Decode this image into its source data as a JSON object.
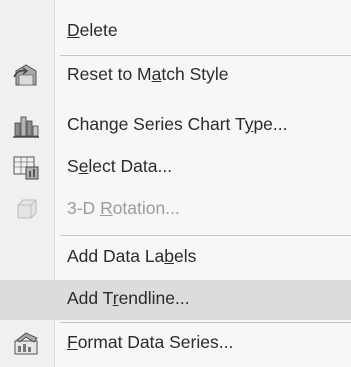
{
  "menu": {
    "items": [
      {
        "id": "delete",
        "pre": "",
        "key": "D",
        "post": "elete",
        "icon": "",
        "disabled": false,
        "hover": false
      },
      {
        "id": "reset-to-match-style",
        "pre": "Reset to M",
        "key": "a",
        "post": "tch Style",
        "icon": "reset-style-icon",
        "disabled": false,
        "hover": false
      },
      {
        "id": "change-series-chart-type",
        "pre": "Change Series Chart T",
        "key": "y",
        "post": "pe...",
        "icon": "chart-type-icon",
        "disabled": false,
        "hover": false
      },
      {
        "id": "select-data",
        "pre": "S",
        "key": "e",
        "post": "lect Data...",
        "icon": "select-data-icon",
        "disabled": false,
        "hover": false
      },
      {
        "id": "3d-rotation",
        "pre": "3-D ",
        "key": "R",
        "post": "otation...",
        "icon": "3d-rotation-icon",
        "disabled": true,
        "hover": false
      },
      {
        "id": "add-data-labels",
        "pre": "Add Data La",
        "key": "b",
        "post": "els",
        "icon": "",
        "disabled": false,
        "hover": false
      },
      {
        "id": "add-trendline",
        "pre": "Add T",
        "key": "r",
        "post": "endline...",
        "icon": "",
        "disabled": false,
        "hover": true
      },
      {
        "id": "format-data-series",
        "pre": "",
        "key": "F",
        "post": "ormat Data Series...",
        "icon": "format-series-icon",
        "disabled": false,
        "hover": false
      }
    ]
  }
}
